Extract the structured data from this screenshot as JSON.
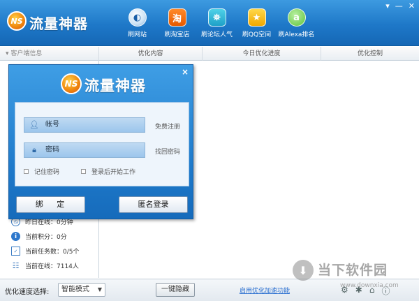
{
  "app": {
    "title": "流量神器",
    "logo_text": "NS"
  },
  "window_controls": [
    "▾",
    "—",
    "✕"
  ],
  "nav": [
    {
      "label": "刷网站",
      "icon": "globe-icon",
      "glyph": "◐"
    },
    {
      "label": "刷淘宝店",
      "icon": "taobao-icon",
      "glyph": "淘"
    },
    {
      "label": "刷论坛人气",
      "icon": "forum-icon",
      "glyph": "⛯"
    },
    {
      "label": "刷QQ空间",
      "icon": "star-icon",
      "glyph": "★"
    },
    {
      "label": "刷Alexa排名",
      "icon": "alexa-icon",
      "glyph": "a"
    }
  ],
  "columns": {
    "left": "▾ 客户端信息",
    "c1": "优化内容",
    "c2": "今日优化进度",
    "c3": "优化控制"
  },
  "info": [
    {
      "icon": "clock-icon",
      "glyph": "◷",
      "text": "昨日在线：0分钟"
    },
    {
      "icon": "info-icon",
      "glyph": "i",
      "text": "当前积分：0分"
    },
    {
      "icon": "task-icon",
      "glyph": "✓",
      "text": "当前任务数：0/5个"
    },
    {
      "icon": "users-icon",
      "glyph": "☷",
      "text": "当前在线：7114人"
    }
  ],
  "bottom": {
    "speed_label": "优化速度选择:",
    "speed_value": "智能模式",
    "hide_button": "一键隐藏",
    "accel_link": "启用优化加速功能",
    "icons": [
      "⚙",
      "✱",
      "⌂",
      "ⓘ"
    ]
  },
  "login": {
    "title": "流量神器",
    "logo_text": "NS",
    "account_label": "帐号",
    "password_label": "密码",
    "register_link": "免费注册",
    "recover_link": "找回密码",
    "remember_label": "记住密码",
    "autostart_label": "登录后开始工作",
    "bind_button": "绑 定",
    "anonymous_button": "匿名登录",
    "close": "×"
  },
  "watermark": {
    "text": "当下软件园",
    "url": "www.downxia.com",
    "glyph": "⬇"
  }
}
